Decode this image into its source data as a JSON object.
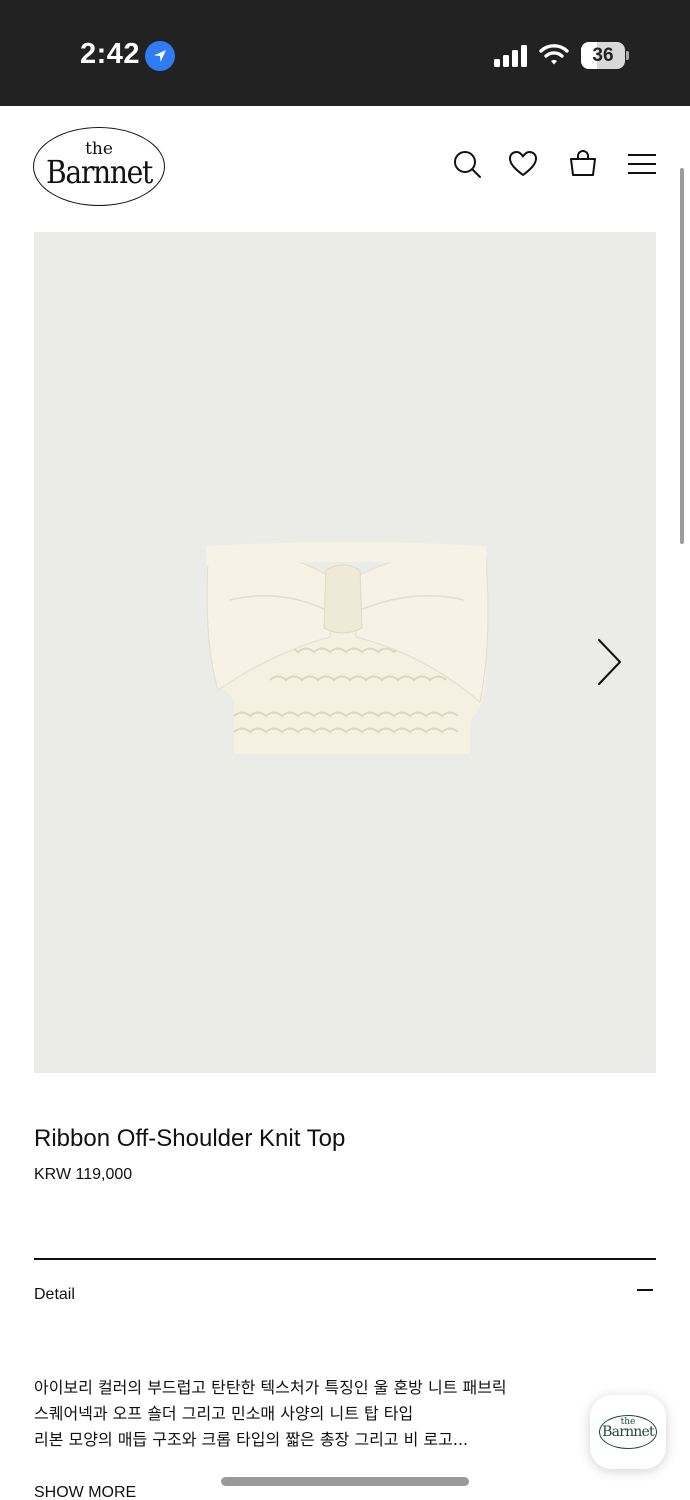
{
  "status_bar": {
    "time": "2:42",
    "battery_level": "36",
    "icons": [
      "location-arrow-icon",
      "cellular-signal-icon",
      "wifi-icon",
      "battery-icon"
    ]
  },
  "header": {
    "logo_small": "the",
    "logo_main": "Barnnet",
    "icons": [
      "search-icon",
      "heart-icon",
      "shopping-bag-icon",
      "menu-icon"
    ]
  },
  "gallery": {
    "next_icon": "chevron-right-icon",
    "background_color": "#ebebe8"
  },
  "product": {
    "title": "Ribbon Off-Shoulder Knit Top",
    "price": "KRW 119,000"
  },
  "detail": {
    "label": "Detail",
    "collapse_icon": "minus-icon",
    "lines": [
      "아이보리 컬러의 부드럽고 탄탄한 텍스처가 특징인 울 혼방 니트 패브릭",
      "스퀘어넥과 오프 숄더 그리고 민소매 사양의 니트 탑 타입",
      "리본 모양의 매듭 구조와 크롭 타입의 짧은 총장 그리고 비 로고..."
    ],
    "show_more": "SHOW MORE"
  },
  "floating_badge": {
    "logo_small": "the",
    "logo_main": "Barnnet"
  }
}
